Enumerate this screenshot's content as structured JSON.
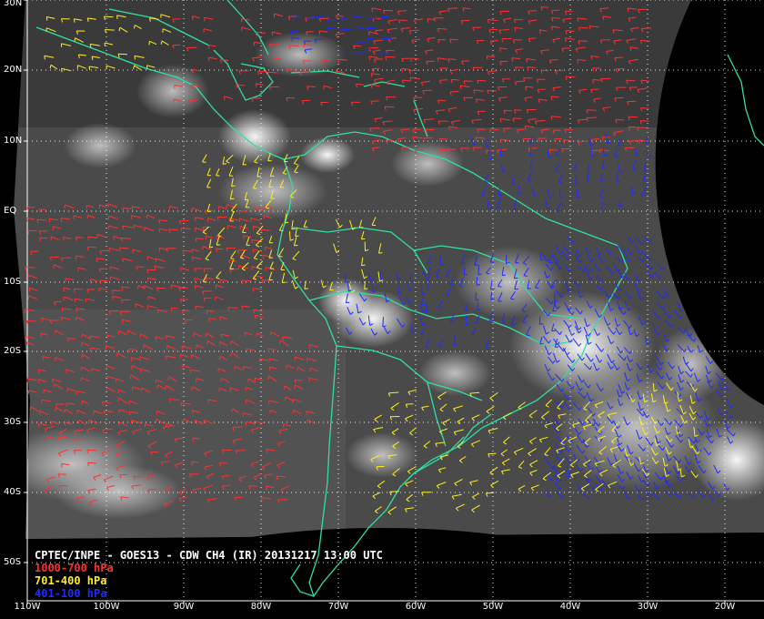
{
  "product": {
    "title": "CPTEC/INPE - GOES13 - CDW CH4 (IR) 20131217 13:00 UTC"
  },
  "legend": [
    {
      "label": "1000-700 hPa",
      "color": "#ff3030"
    },
    {
      "label": "701-400 hPa",
      "color": "#ffee22"
    },
    {
      "label": "401-100 hPa",
      "color": "#1e2cff"
    }
  ],
  "colors": {
    "coastline": "#30e0a0",
    "grid": "#ffffff",
    "background": "#000000"
  },
  "latitude_labels": [
    "30N",
    "20N",
    "10N",
    "EQ",
    "10S",
    "20S",
    "30S",
    "40S",
    "50S"
  ],
  "longitude_labels": [
    "110W",
    "100W",
    "90W",
    "80W",
    "70W",
    "60W",
    "50W",
    "40W",
    "30W",
    "20W"
  ]
}
